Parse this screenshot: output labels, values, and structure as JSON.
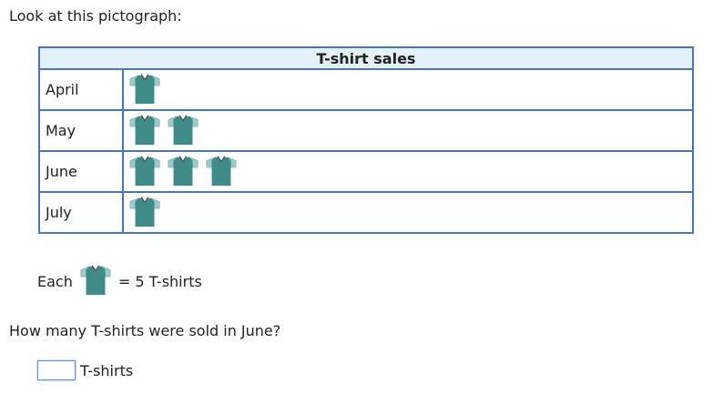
{
  "intro_text": "Look at this pictograph:",
  "pictograph": {
    "title": "T-shirt sales",
    "icon": "t-shirt-icon",
    "colors": {
      "shirt_body": "#3f8b88",
      "shirt_sleeve": "#9ccac6",
      "border": "#4a76b8",
      "header_bg": "#e3f1fb"
    },
    "rows": [
      {
        "label": "April",
        "count": 1
      },
      {
        "label": "May",
        "count": 2
      },
      {
        "label": "June",
        "count": 3
      },
      {
        "label": "July",
        "count": 1
      }
    ]
  },
  "key": {
    "prefix": "Each",
    "suffix": "= 5 T-shirts"
  },
  "question": "How many T-shirts were sold in June?",
  "answer": {
    "value": "",
    "unit": "T-shirts"
  }
}
